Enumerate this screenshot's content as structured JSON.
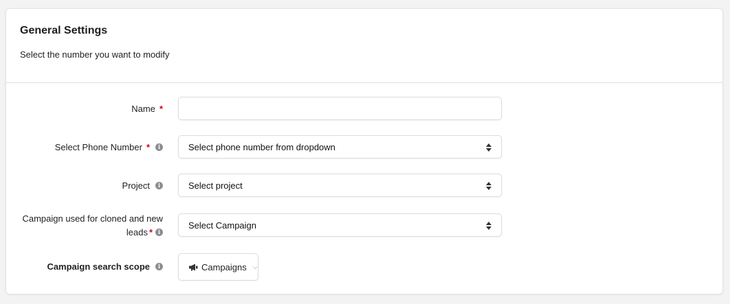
{
  "header": {
    "title": "General Settings",
    "subtitle": "Select the number you want to modify"
  },
  "form": {
    "name": {
      "label": "Name",
      "required_mark": "*",
      "value": "",
      "placeholder": ""
    },
    "phone": {
      "label": "Select Phone Number",
      "required_mark": "*",
      "selected": "Select phone number from dropdown"
    },
    "project": {
      "label": "Project",
      "selected": "Select project"
    },
    "campaign": {
      "label": "Campaign used for cloned and new leads",
      "required_mark": "*",
      "selected": "Select Campaign"
    },
    "scope": {
      "label": "Campaign search scope",
      "button_label": "Campaigns",
      "icon": "megaphone-icon"
    }
  },
  "info_icon_glyph": "i",
  "colors": {
    "required": "#d0021b",
    "info_icon": "#8d8d92"
  }
}
